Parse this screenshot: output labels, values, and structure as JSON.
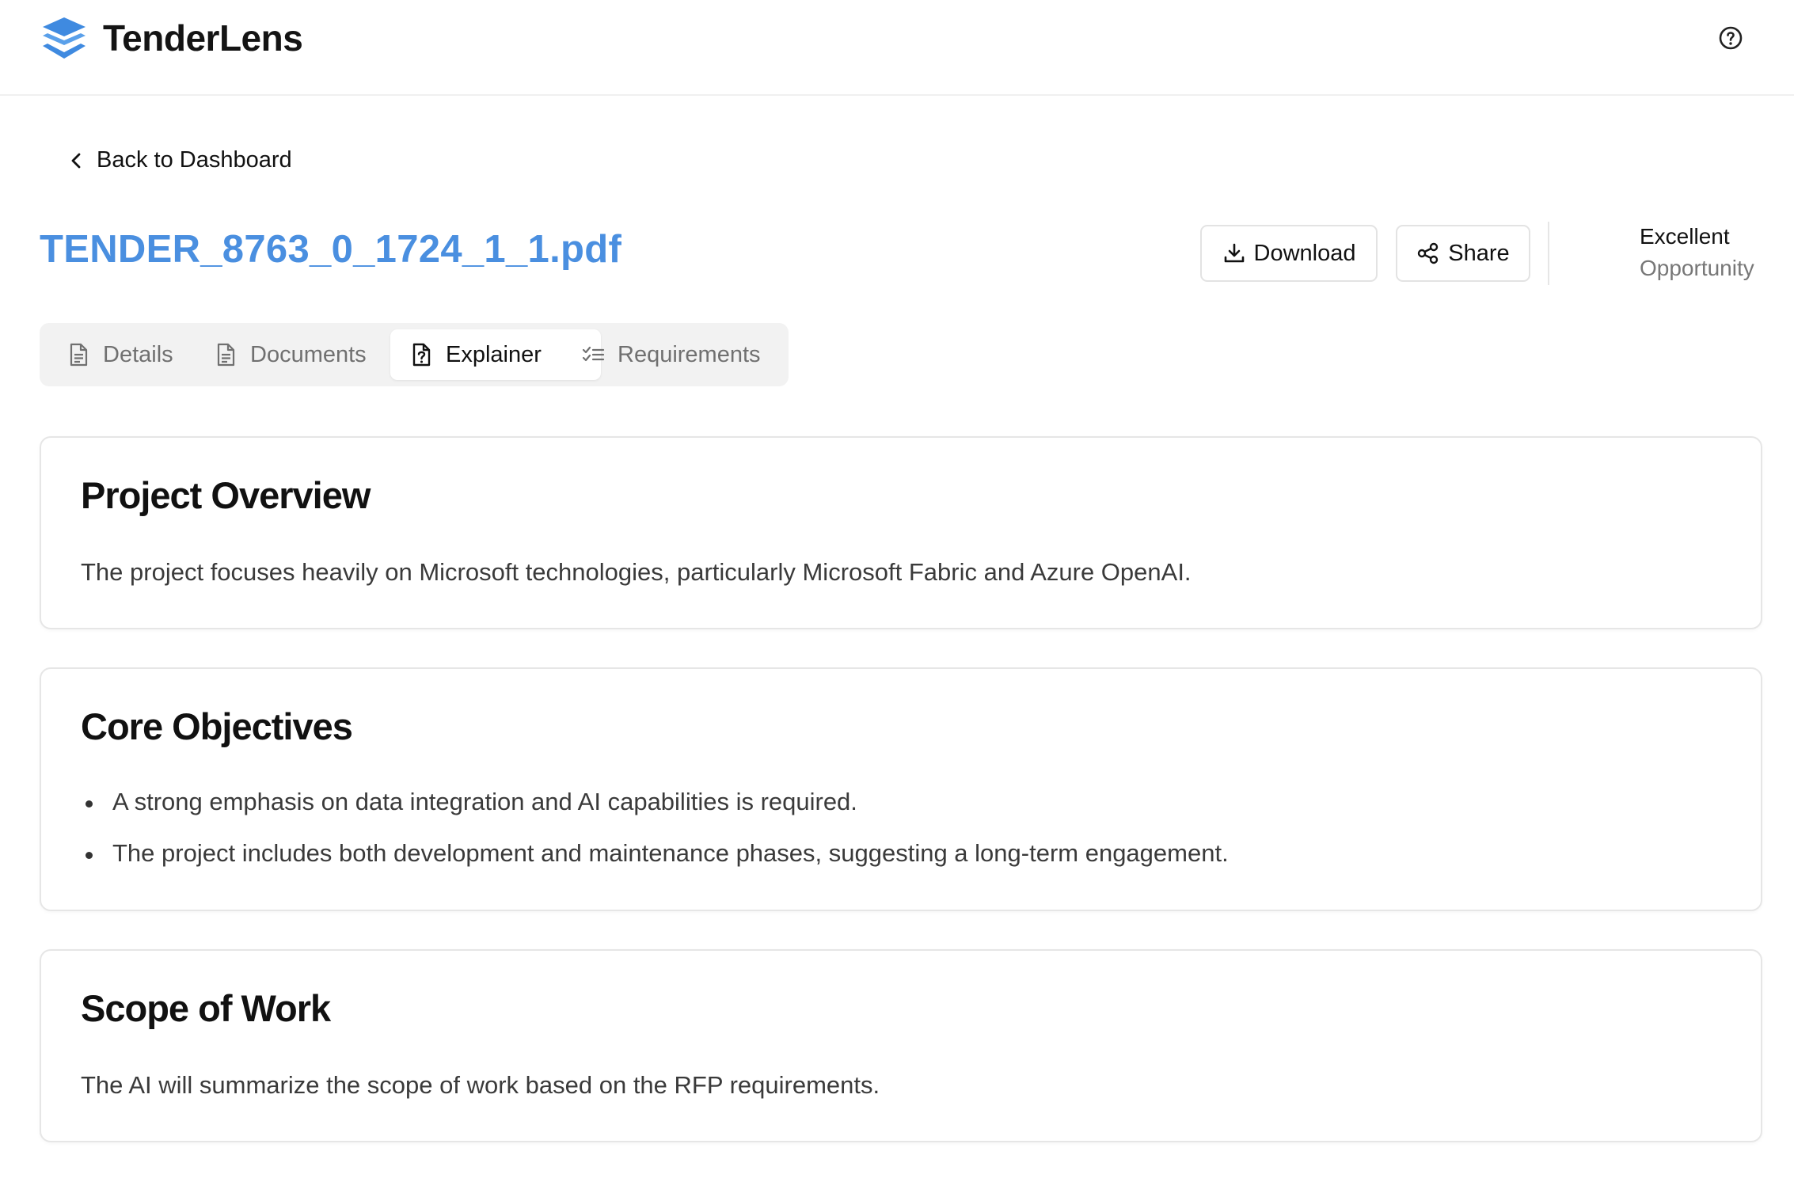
{
  "app": {
    "name": "TenderLens",
    "brand_color": "#3f8ae0"
  },
  "header": {
    "logo_icon": "stacked-layers-icon",
    "help_icon": "help-circle-icon"
  },
  "nav": {
    "back_label": "Back to Dashboard"
  },
  "document": {
    "title": "TENDER_8763_0_1724_1_1.pdf",
    "title_color": "#4a8fe0"
  },
  "actions": {
    "download_label": "Download",
    "share_label": "Share"
  },
  "rating": {
    "label": "Excellent",
    "sub_label": "Opportunity"
  },
  "tabs": [
    {
      "label": "Details",
      "icon": "file-text-icon",
      "active": false
    },
    {
      "label": "Documents",
      "icon": "file-text-icon",
      "active": false
    },
    {
      "label": "Explainer",
      "icon": "file-question-icon",
      "active": true
    },
    {
      "label": "Requirements",
      "icon": "list-checks-icon",
      "active": false
    }
  ],
  "sections": {
    "overview": {
      "title": "Project Overview",
      "text": "The project focuses heavily on Microsoft technologies, particularly Microsoft Fabric and Azure OpenAI."
    },
    "objectives": {
      "title": "Core Objectives",
      "items": [
        "A strong emphasis on data integration and AI capabilities is required.",
        "The project includes both development and maintenance phases, suggesting a long-term engagement."
      ]
    },
    "scope": {
      "title": "Scope of Work",
      "text": "The AI will summarize the scope of work based on the RFP requirements."
    }
  }
}
